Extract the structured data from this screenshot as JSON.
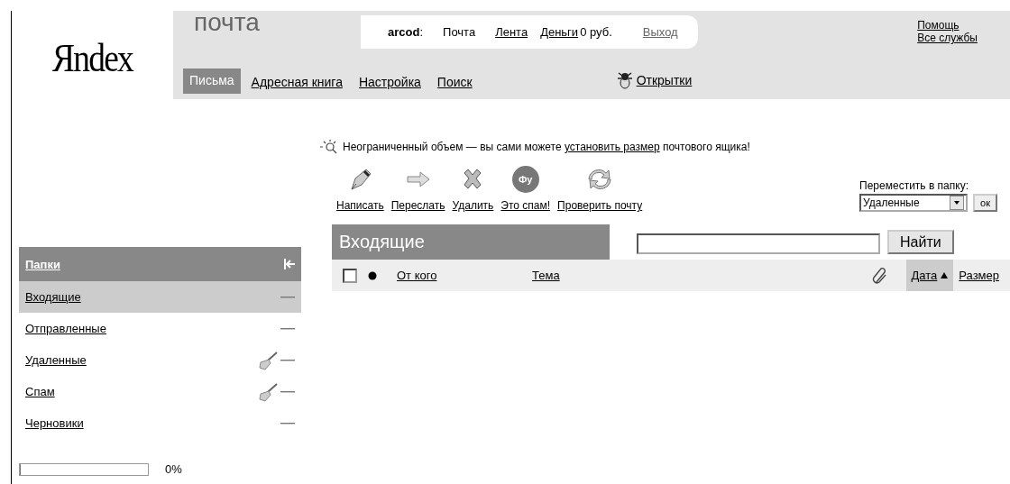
{
  "header": {
    "logo": "Яndex",
    "service": "почта",
    "user": "arcod",
    "user_sep": ":",
    "top_links": [
      {
        "label": "Почта",
        "current": true
      },
      {
        "label": "Лента",
        "current": false
      },
      {
        "label": "Деньги",
        "current": false
      }
    ],
    "balance": "0 руб.",
    "logout": "Выход",
    "help_links": [
      "Помощь",
      "Все службы"
    ],
    "tabs": [
      {
        "label": "Письма",
        "selected": true
      },
      {
        "label": "Адресная книга",
        "selected": false
      },
      {
        "label": "Настройка",
        "selected": false
      },
      {
        "label": "Поиск",
        "selected": false
      }
    ],
    "postcards": "Открытки"
  },
  "notice": {
    "before": "Неограниченный объем — вы сами можете ",
    "link": "установить размер",
    "after": " почтового ящика!"
  },
  "toolbar": [
    {
      "kind": "write",
      "label": "Написать"
    },
    {
      "kind": "forward",
      "label": "Переслать"
    },
    {
      "kind": "delete",
      "label": "Удалить"
    },
    {
      "kind": "spam",
      "label": "Это спам!",
      "icon_text": "Фу"
    },
    {
      "kind": "check",
      "label": "Проверить почту"
    }
  ],
  "move_to": {
    "label": "Переместить в папку:",
    "value": "Удаленные",
    "button": "ок"
  },
  "sidebar": {
    "title": "Папки",
    "folders": [
      {
        "name": "Входящие",
        "selected": true,
        "clean": false
      },
      {
        "name": "Отправленные",
        "selected": false,
        "clean": false
      },
      {
        "name": "Удаленные",
        "selected": false,
        "clean": true
      },
      {
        "name": "Спам",
        "selected": false,
        "clean": true
      },
      {
        "name": "Черновики",
        "selected": false,
        "clean": false
      }
    ],
    "quota": {
      "level": 0,
      "reading": "0%"
    }
  },
  "inbox": {
    "title": "Входящие",
    "search_button": "Найти",
    "columns": [
      {
        "kind": "checkbox",
        "checked": false
      },
      {
        "kind": "dot"
      },
      {
        "kind": "link",
        "label": "От кого",
        "sorted": false
      },
      {
        "kind": "link",
        "label": "Тема",
        "sorted": false
      },
      {
        "kind": "attach"
      },
      {
        "kind": "link",
        "label": "Дата",
        "sorted": true
      },
      {
        "kind": "link",
        "label": "Размер",
        "sorted": false
      }
    ]
  }
}
